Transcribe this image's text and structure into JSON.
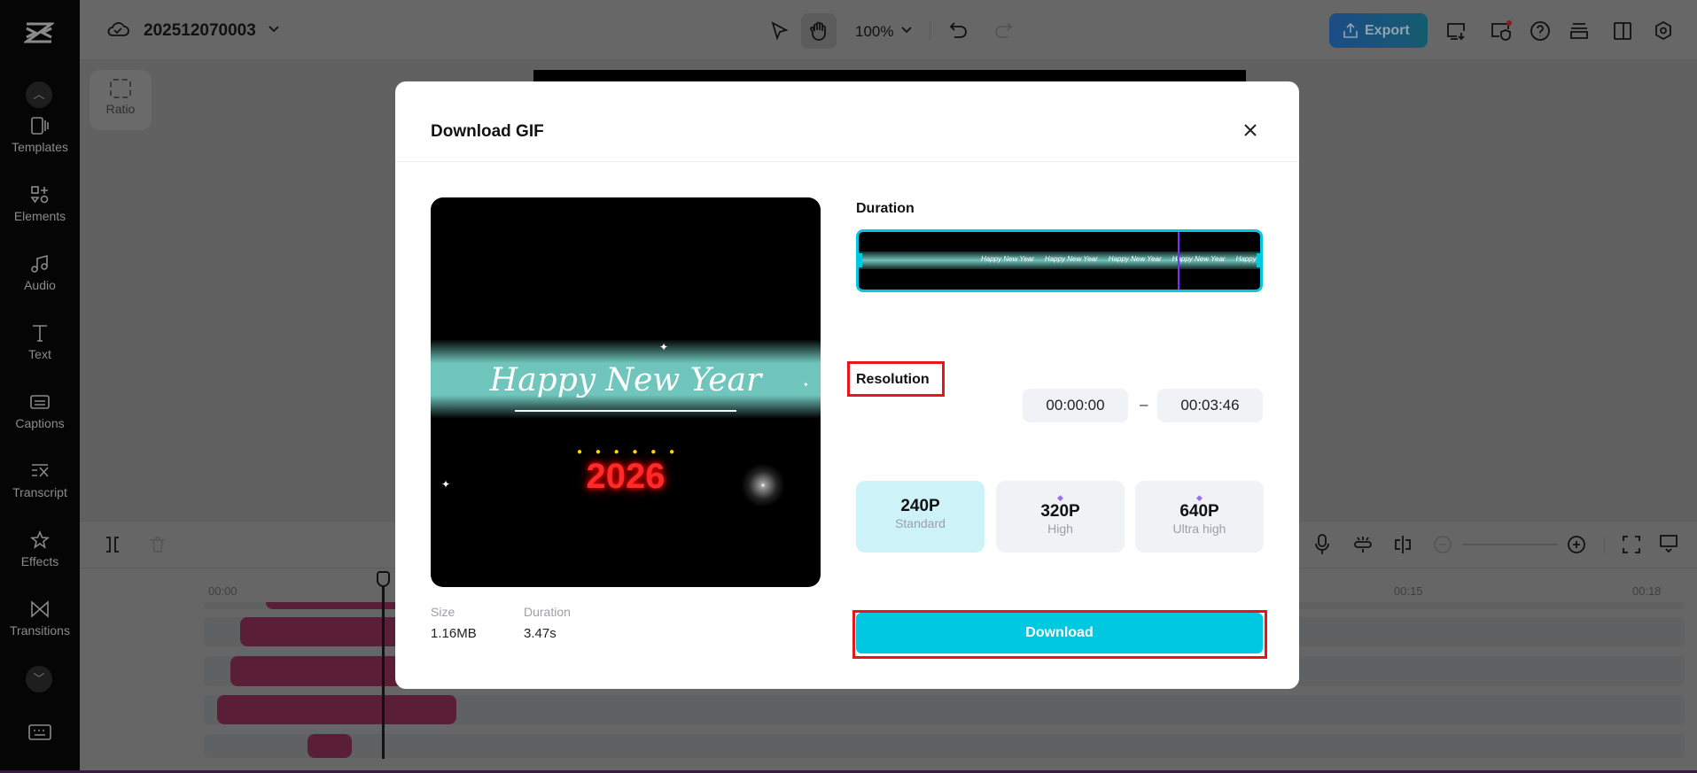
{
  "header": {
    "project_title": "202512070003",
    "zoom": "100%",
    "export_label": "Export"
  },
  "sidebar": {
    "items": [
      {
        "label": "Templates"
      },
      {
        "label": "Elements"
      },
      {
        "label": "Audio"
      },
      {
        "label": "Text"
      },
      {
        "label": "Captions"
      },
      {
        "label": "Transcript"
      },
      {
        "label": "Effects"
      },
      {
        "label": "Transitions"
      }
    ]
  },
  "canvas": {
    "ratio_label": "Ratio"
  },
  "timeline": {
    "ruler": [
      "00:00",
      "00:15",
      "00:18"
    ]
  },
  "modal": {
    "title": "Download GIF",
    "preview": {
      "text": "Happy New Year",
      "year": "2026"
    },
    "info": {
      "size_label": "Size",
      "size_value": "1.16MB",
      "duration_label": "Duration",
      "duration_value": "3.47s"
    },
    "duration_label": "Duration",
    "strip_frame_text": "Happy New Year",
    "start_time": "00:00:00",
    "dash": "–",
    "end_time": "00:03:46",
    "resolution_label": "Resolution",
    "resolutions": [
      {
        "value": "240P",
        "desc": "Standard",
        "selected": true
      },
      {
        "value": "320P",
        "desc": "High",
        "premium": true
      },
      {
        "value": "640P",
        "desc": "Ultra high",
        "premium": true
      }
    ],
    "download_label": "Download"
  },
  "colors": {
    "accent": "#00c8e0",
    "selected": "#cdf3f8",
    "highlight": "#e8161b",
    "premium": "#9b6bff"
  }
}
